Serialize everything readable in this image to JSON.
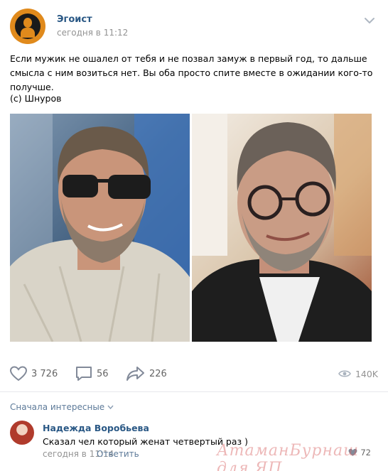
{
  "post": {
    "author": "Эгоист",
    "time": "сегодня в 11:12",
    "text": "Если мужик не ошалел от тебя и не позвал замуж в первый год, то дальше смысла с ним возиться нет. Вы оба просто спите вместе в ожидании кого-то получше.",
    "quote": "(с) Шнуров",
    "photos": [
      "photo-sunglasses",
      "photo-glasses"
    ]
  },
  "actions": {
    "likes": "3 726",
    "comments": "56",
    "shares": "226",
    "views": "140K"
  },
  "comments_section": {
    "sort_label": "Сначала интересные",
    "items": [
      {
        "name": "Надежда Воробьева",
        "text": "Сказал чел который женат четвертый раз )",
        "time": "сегодня в 11:14",
        "reply_label": "Ответить",
        "likes": "72"
      }
    ]
  },
  "watermark": "АтаманБурнаш для ЯП",
  "colors": {
    "link": "#2a5885",
    "muted": "#939393",
    "icon": "#828a99",
    "divider": "#e7e8ec"
  }
}
